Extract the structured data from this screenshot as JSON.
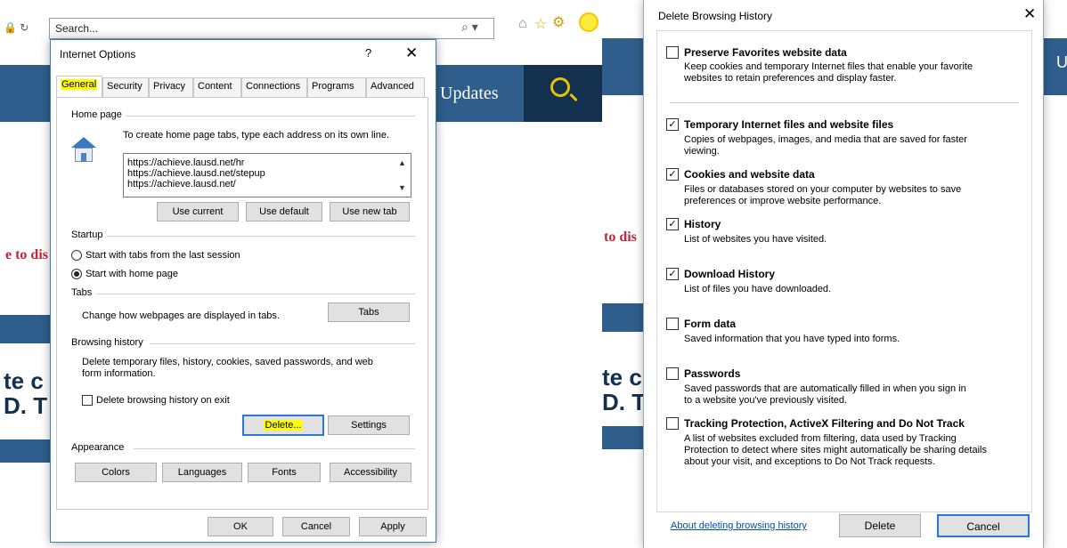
{
  "browser": {
    "search_placeholder": "Search...",
    "search_arrow": "⌕ ▾",
    "updates": "Updates",
    "fragment_red_left": "e to dis",
    "fragment_big_left_1": "te c",
    "fragment_big_left_2": "D. T",
    "fragment_red_right": "to dis",
    "fragment_big_right_1": "te c",
    "fragment_big_right_2": "D. T",
    "fragment_u": "U"
  },
  "internet_options": {
    "title": "Internet Options",
    "help_glyph": "?",
    "close_glyph": "✕",
    "tabs": [
      {
        "label": "General"
      },
      {
        "label": "Security"
      },
      {
        "label": "Privacy"
      },
      {
        "label": "Content"
      },
      {
        "label": "Connections"
      },
      {
        "label": "Programs"
      },
      {
        "label": "Advanced"
      }
    ],
    "home_page": {
      "label": "Home page",
      "description": "To create home page tabs, type each address on its own line.",
      "urls": [
        "https://achieve.lausd.net/hr",
        "https://achieve.lausd.net/stepup",
        "https://achieve.lausd.net/"
      ],
      "use_current": "Use current",
      "use_default": "Use default",
      "use_new_tab": "Use new tab"
    },
    "startup": {
      "label": "Startup",
      "option_last_session": "Start with tabs from the last session",
      "option_home_page": "Start with home page",
      "selected": "Start with home page"
    },
    "tabs_group": {
      "label": "Tabs",
      "description": "Change how webpages are displayed in tabs.",
      "button": "Tabs"
    },
    "browsing_history": {
      "label": "Browsing history",
      "description_line1": "Delete temporary files, history, cookies, saved passwords, and web",
      "description_line2": "form information.",
      "delete_on_exit": "Delete browsing history on exit",
      "delete_on_exit_checked": false,
      "delete_button": "Delete...",
      "settings_button": "Settings"
    },
    "appearance": {
      "label": "Appearance",
      "colors": "Colors",
      "languages": "Languages",
      "fonts": "Fonts",
      "accessibility": "Accessibility"
    },
    "footer": {
      "ok": "OK",
      "cancel": "Cancel",
      "apply": "Apply"
    }
  },
  "delete_history": {
    "title": "Delete Browsing History",
    "close_glyph": "✕",
    "options": [
      {
        "title": "Preserve Favorites website data",
        "desc1": "Keep cookies and temporary Internet files that enable your favorite",
        "desc2": "websites to retain preferences and display faster.",
        "desc3": "",
        "checked": false
      },
      {
        "title": "Temporary Internet files and website files",
        "desc1": "Copies of webpages, images, and media that are saved for faster",
        "desc2": "viewing.",
        "desc3": "",
        "checked": true
      },
      {
        "title": "Cookies and website data",
        "desc1": "Files or databases stored on your computer by websites to save",
        "desc2": "preferences or improve website performance.",
        "desc3": "",
        "checked": true
      },
      {
        "title": "History",
        "desc1": "List of websites you have visited.",
        "desc2": "",
        "desc3": "",
        "checked": true
      },
      {
        "title": "Download History",
        "desc1": "List of files you have downloaded.",
        "desc2": "",
        "desc3": "",
        "checked": true
      },
      {
        "title": "Form data",
        "desc1": "Saved information that you have typed into forms.",
        "desc2": "",
        "desc3": "",
        "checked": false
      },
      {
        "title": "Passwords",
        "desc1": "Saved passwords that are automatically filled in when you sign in",
        "desc2": "to a website you've previously visited.",
        "desc3": "",
        "checked": false
      },
      {
        "title": "Tracking Protection, ActiveX Filtering and Do Not Track",
        "desc1": "A list of websites excluded from filtering, data used by Tracking",
        "desc2": "Protection to detect where sites might automatically be sharing details",
        "desc3": "about your visit, and exceptions to Do Not Track requests.",
        "checked": false
      }
    ],
    "about_link": "About deleting browsing history",
    "delete_button": "Delete",
    "cancel_button": "Cancel"
  },
  "colors": {
    "highlight": "#ffff00",
    "brand_blue": "#2f5e8c",
    "dark_navy": "#13304f",
    "accent_red": "#c0263c",
    "focus_blue": "#2a78d6"
  }
}
